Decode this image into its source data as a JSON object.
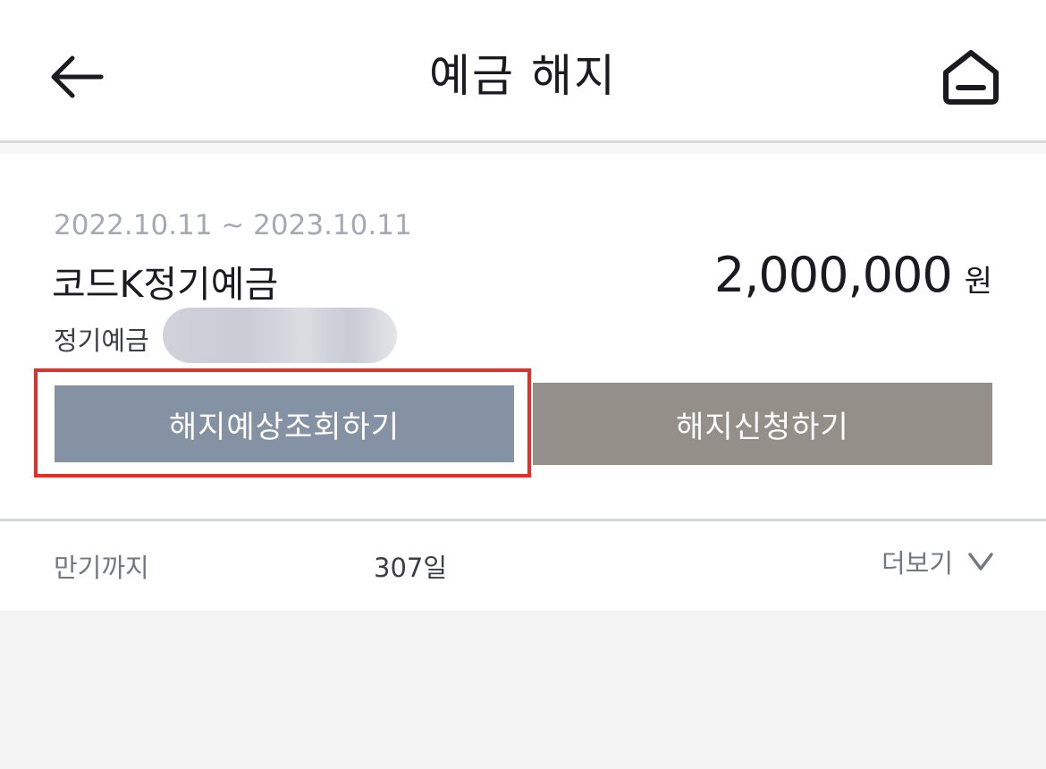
{
  "header": {
    "title": "예금 해지",
    "back_icon": "arrow-left-icon",
    "home_icon": "home-icon"
  },
  "deposit": {
    "period": "2022.10.11 ~ 2023.10.11",
    "product_name": "코드K정기예금",
    "amount": "2,000,000",
    "currency": "원",
    "type_label": "정기예금"
  },
  "actions": {
    "estimate_label": "해지예상조회하기",
    "apply_label": "해지신청하기"
  },
  "footer_row": {
    "maturity_label": "만기까지",
    "maturity_value": "307일",
    "more_label": "더보기"
  },
  "colors": {
    "estimate_button": "#8592a4",
    "apply_button": "#948f89",
    "highlight": "#e0312a"
  }
}
